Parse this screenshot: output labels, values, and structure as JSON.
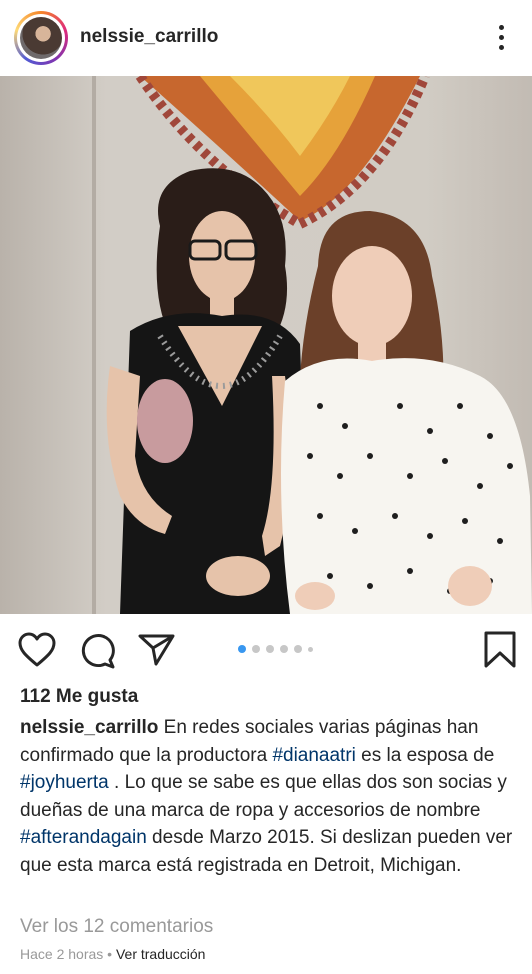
{
  "header": {
    "username": "nelssie_carrillo"
  },
  "actions": {
    "carousel_total": 6,
    "carousel_active_index": 0
  },
  "post": {
    "likes": "112 Me gusta",
    "caption_user": "nelssie_carrillo",
    "caption_parts": {
      "t1": "En redes sociales varias páginas han confirmado que la productora ",
      "tag1": "#dianaatri",
      "t2": " es la esposa de ",
      "tag2": "#joyhuerta",
      "t3": " . Lo que se sabe es que ellas dos son socias y dueñas de una marca de ropa y accesorios de nombre ",
      "tag3": "#afterandagain",
      "t4": " desde Marzo 2015. Si deslizan pueden ver que esta marca está registrada en Detroit, Michigan."
    },
    "view_comments": "Ver los 12 comentarios",
    "time": "Hace 2 horas",
    "separator": " • ",
    "translate": "Ver traducción"
  }
}
